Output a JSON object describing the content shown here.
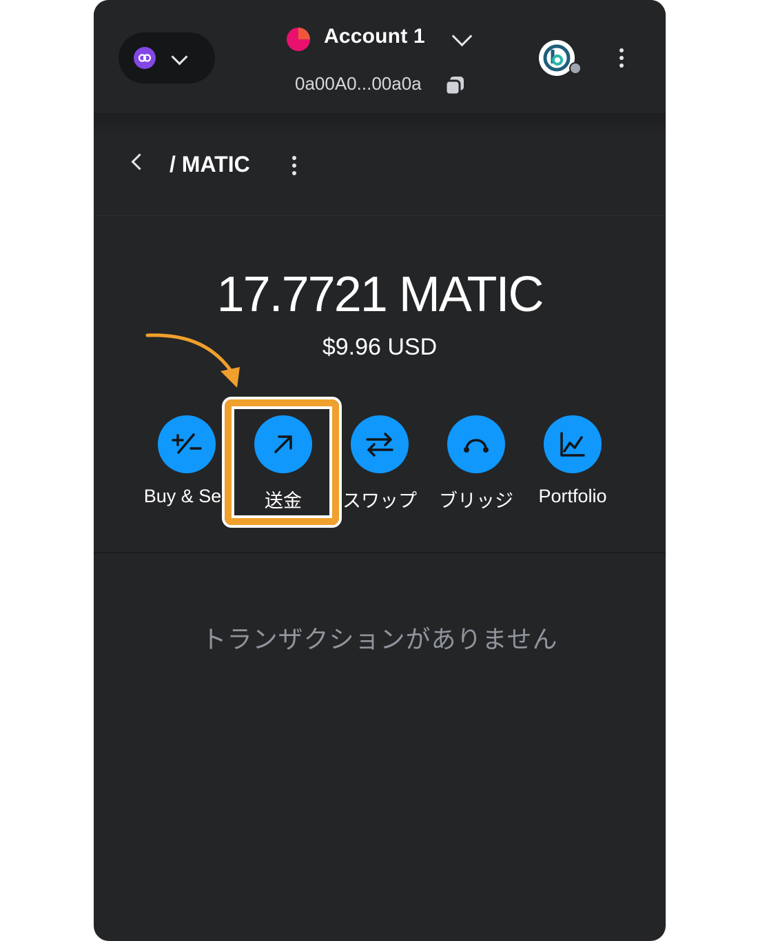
{
  "header": {
    "network_icon": "polygon-icon",
    "account_name": "Account 1",
    "account_address": "0a00A0...00a0a",
    "copy_icon": "copy-icon",
    "site_icon": "connected-site-icon"
  },
  "token": {
    "title": "/ MATIC",
    "balance": "17.7721 MATIC",
    "fiat": "$9.96 USD"
  },
  "actions": [
    {
      "label": "Buy & Sell",
      "icon": "plus-minus-icon"
    },
    {
      "label": "送金",
      "icon": "arrow-up-right-icon"
    },
    {
      "label": "スワップ",
      "icon": "swap-arrows-icon"
    },
    {
      "label": "ブリッジ",
      "icon": "bridge-icon"
    },
    {
      "label": "Portfolio",
      "icon": "chart-line-icon"
    }
  ],
  "transactions": {
    "empty_text": "トランザクションがありません"
  },
  "colors": {
    "background": "#242527",
    "accent": "#1098fc",
    "highlight": "#f0a02c"
  }
}
